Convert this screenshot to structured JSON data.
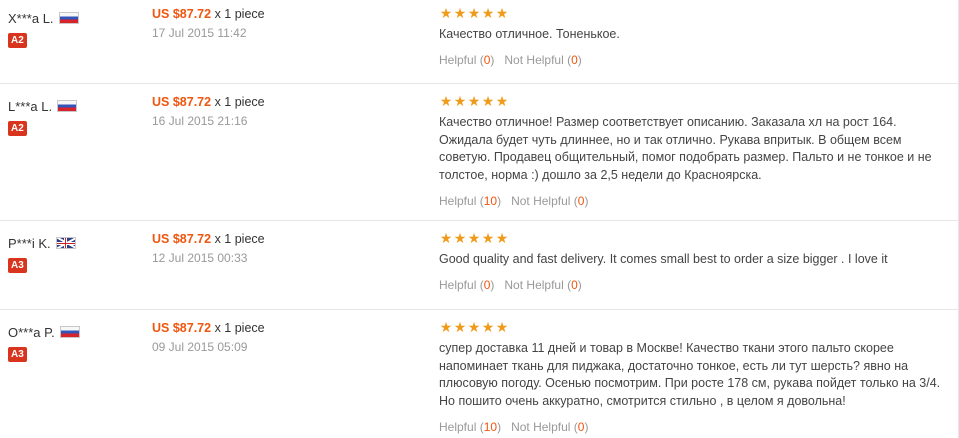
{
  "colors": {
    "price": "#f0560e",
    "star": "#f09a1a",
    "badge": "#d9341e",
    "muted": "#999999",
    "divider": "#e6e6e6"
  },
  "reviews": [
    {
      "user": "X***a L.",
      "flag": "flag-ru-icon",
      "level": "A2",
      "price": "US $87.72",
      "qty": "x 1 piece",
      "date": "17 Jul 2015 11:42",
      "rating": 5,
      "text": "Качество отличное. Тоненькое.",
      "helpful_label": "Helpful",
      "helpful_count": "0",
      "not_helpful_label": "Not Helpful",
      "not_helpful_count": "0"
    },
    {
      "user": "L***a L.",
      "flag": "flag-ru-icon",
      "level": "A2",
      "price": "US $87.72",
      "qty": "x 1 piece",
      "date": "16 Jul 2015 21:16",
      "rating": 5,
      "text": "Качество отличное! Размер соответствует описанию. Заказала хл на рост 164. Ожидала будет чуть длиннее, но и так отлично. Рукава впритык. В общем всем советую. Продавец общительный, помог подобрать размер. Пальто и не тонкое и не толстое, норма :) дошло за 2,5 недели до Красноярска.",
      "helpful_label": "Helpful",
      "helpful_count": "10",
      "not_helpful_label": "Not Helpful",
      "not_helpful_count": "0"
    },
    {
      "user": "P***i K.",
      "flag": "flag-gb-icon",
      "level": "A3",
      "price": "US $87.72",
      "qty": "x 1 piece",
      "date": "12 Jul 2015 00:33",
      "rating": 5,
      "text": "Good quality and fast delivery. It comes small best to order a size bigger . I love it",
      "helpful_label": "Helpful",
      "helpful_count": "0",
      "not_helpful_label": "Not Helpful",
      "not_helpful_count": "0"
    },
    {
      "user": "O***a P.",
      "flag": "flag-ru-icon",
      "level": "A3",
      "price": "US $87.72",
      "qty": "x 1 piece",
      "date": "09 Jul 2015 05:09",
      "rating": 5,
      "text": "супер доставка 11 дней и товар в Москве! Качество ткани этого пальто скорее напоминает ткань для пиджака, достаточно тонкое, есть ли тут шерсть? явно на плюсовую погоду. Осенью посмотрим. При росте 178 см, рукава пойдет только на 3/4. Но пошито очень аккуратно, смотрится стильно , в целом я довольна!",
      "helpful_label": "Helpful",
      "helpful_count": "10",
      "not_helpful_label": "Not Helpful",
      "not_helpful_count": "0"
    }
  ]
}
